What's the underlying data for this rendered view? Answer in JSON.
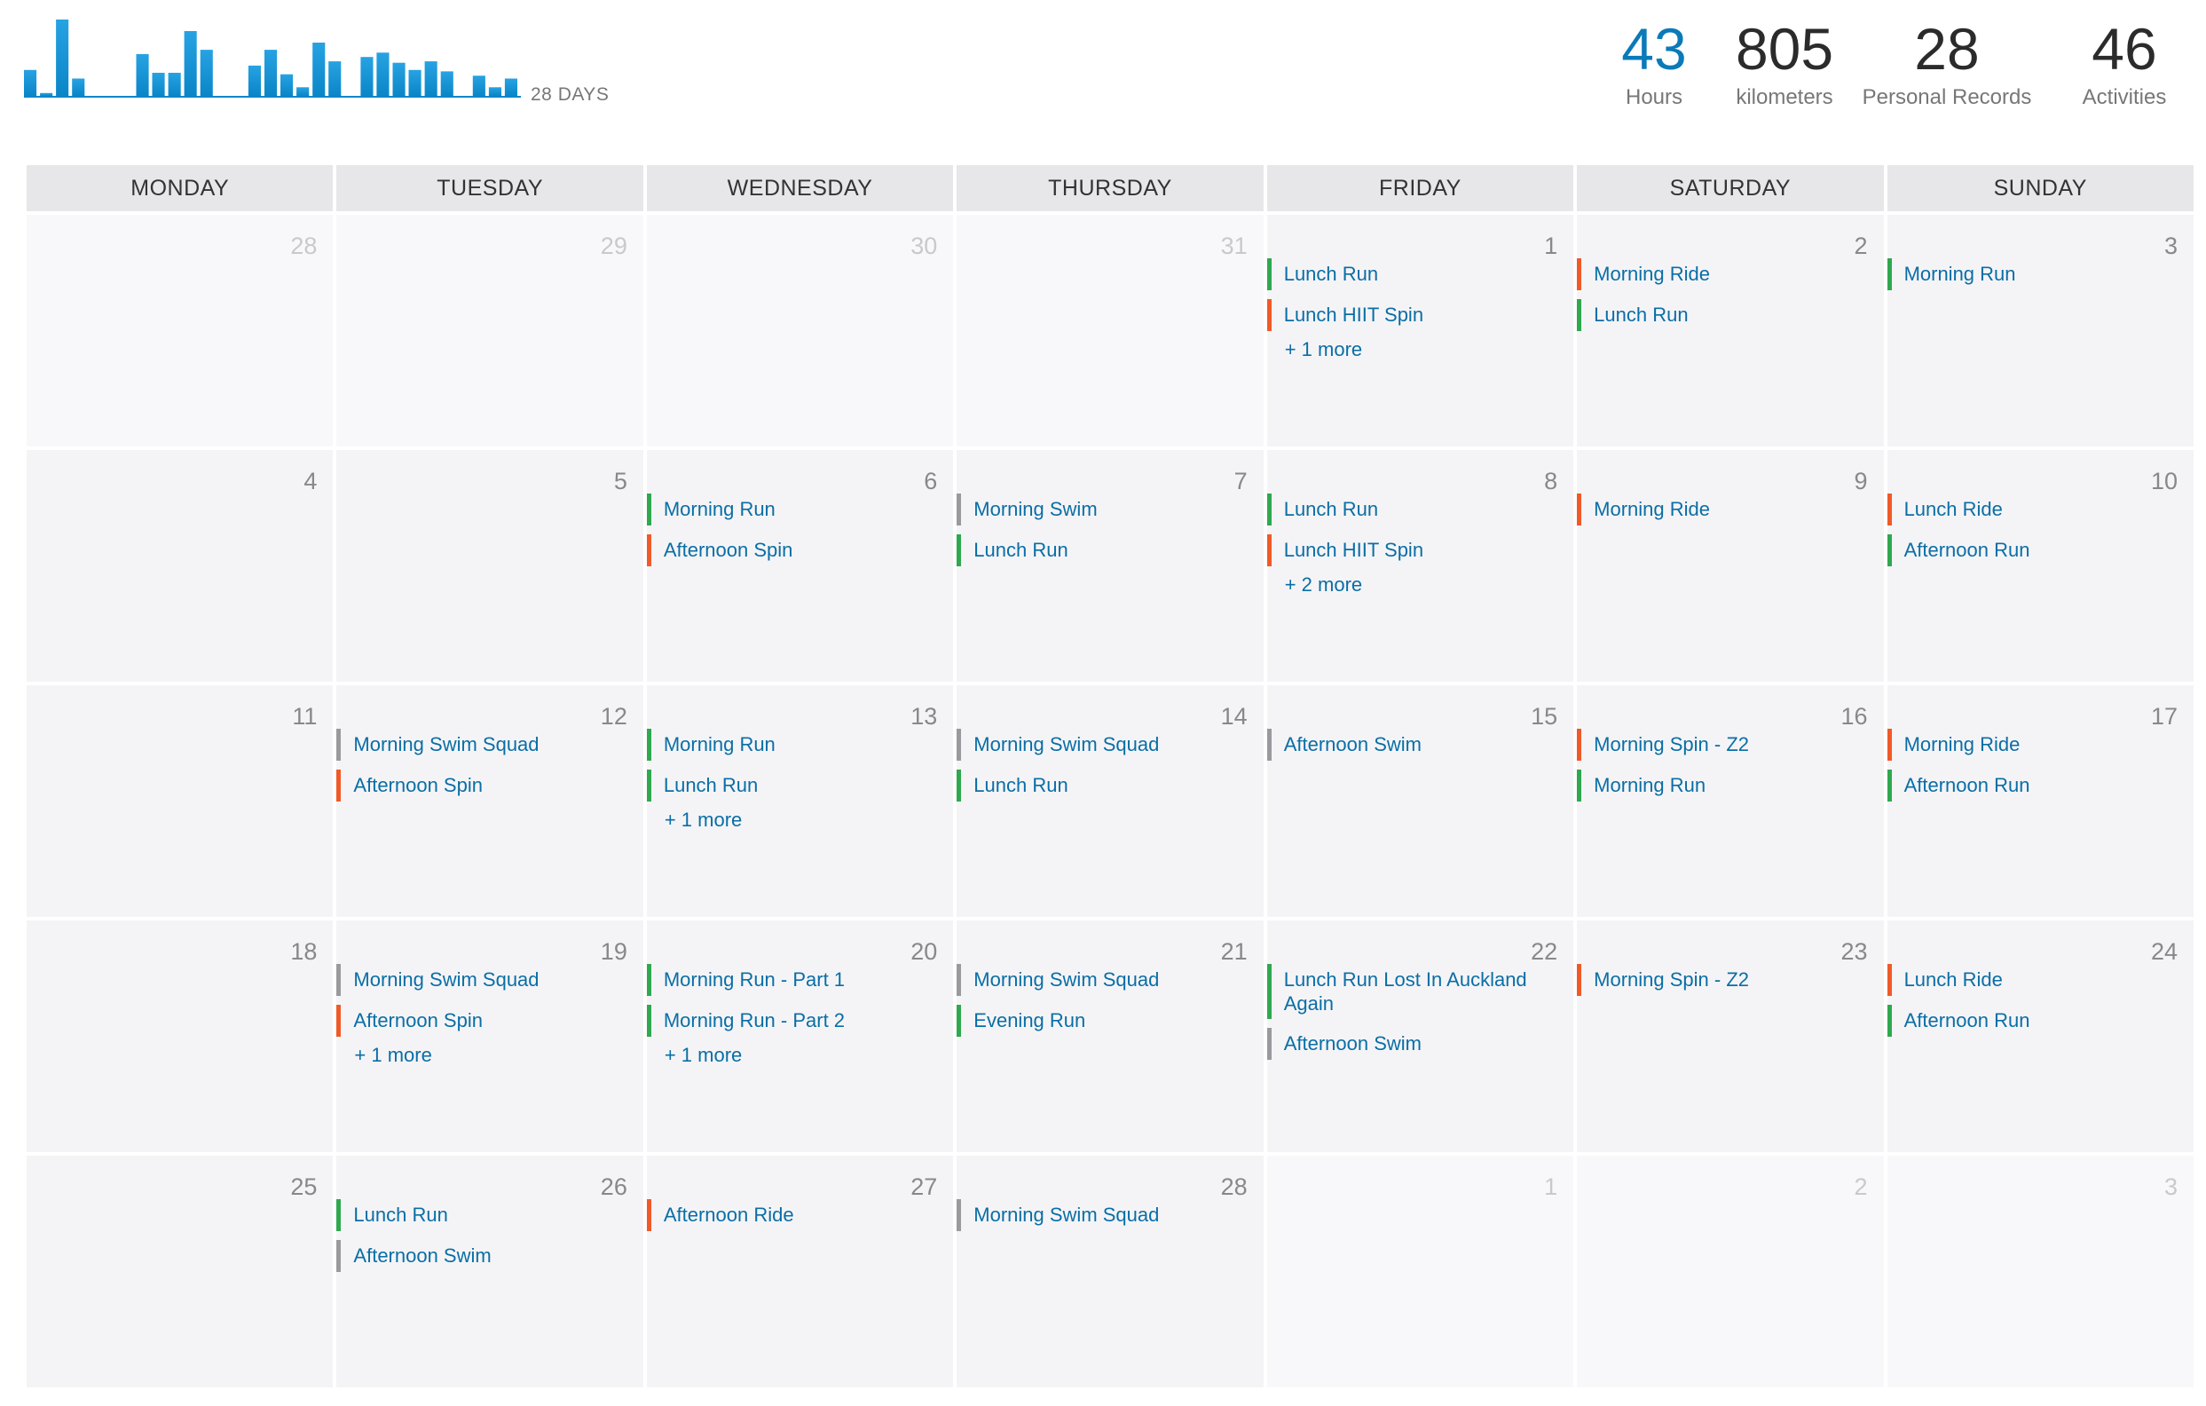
{
  "summary": {
    "days_label": "28 DAYS",
    "hours": {
      "value": "43",
      "label": "Hours"
    },
    "kilometers": {
      "value": "805",
      "label": "kilometers"
    },
    "records": {
      "value": "28",
      "label": "Personal Records"
    },
    "activities": {
      "value": "46",
      "label": "Activities"
    }
  },
  "chart_data": {
    "type": "bar",
    "title": "",
    "values": [
      1.8,
      0.2,
      5.3,
      1.2,
      0,
      0,
      0,
      2.9,
      1.6,
      1.6,
      4.5,
      3.2,
      0,
      0,
      2.1,
      3.2,
      1.5,
      0.6,
      3.7,
      2.4,
      0,
      2.7,
      3.0,
      2.3,
      1.8,
      2.4,
      1.7,
      0,
      1.4,
      0.6,
      1.2
    ],
    "color": "#0a86c8"
  },
  "calendar": {
    "day_headers": [
      "MONDAY",
      "TUESDAY",
      "WEDNESDAY",
      "THURSDAY",
      "FRIDAY",
      "SATURDAY",
      "SUNDAY"
    ],
    "weeks": [
      [
        {
          "day": "28",
          "other": true,
          "events": []
        },
        {
          "day": "29",
          "other": true,
          "events": []
        },
        {
          "day": "30",
          "other": true,
          "events": []
        },
        {
          "day": "31",
          "other": true,
          "events": []
        },
        {
          "day": "1",
          "events": [
            {
              "name": "Lunch Run",
              "type": "run"
            },
            {
              "name": "Lunch HIIT Spin",
              "type": "ride"
            }
          ],
          "more": "+ 1 more"
        },
        {
          "day": "2",
          "events": [
            {
              "name": "Morning Ride",
              "type": "ride"
            },
            {
              "name": "Lunch Run",
              "type": "run"
            }
          ]
        },
        {
          "day": "3",
          "events": [
            {
              "name": "Morning Run",
              "type": "run"
            }
          ]
        }
      ],
      [
        {
          "day": "4",
          "events": []
        },
        {
          "day": "5",
          "events": []
        },
        {
          "day": "6",
          "events": [
            {
              "name": "Morning Run",
              "type": "run"
            },
            {
              "name": "Afternoon Spin",
              "type": "ride"
            }
          ]
        },
        {
          "day": "7",
          "events": [
            {
              "name": "Morning Swim",
              "type": "swim"
            },
            {
              "name": "Lunch Run",
              "type": "run"
            }
          ]
        },
        {
          "day": "8",
          "events": [
            {
              "name": "Lunch Run",
              "type": "run"
            },
            {
              "name": "Lunch HIIT Spin",
              "type": "ride"
            }
          ],
          "more": "+ 2 more"
        },
        {
          "day": "9",
          "events": [
            {
              "name": "Morning Ride",
              "type": "ride"
            }
          ]
        },
        {
          "day": "10",
          "events": [
            {
              "name": "Lunch Ride",
              "type": "ride"
            },
            {
              "name": "Afternoon Run",
              "type": "run"
            }
          ]
        }
      ],
      [
        {
          "day": "11",
          "events": []
        },
        {
          "day": "12",
          "events": [
            {
              "name": "Morning Swim Squad",
              "type": "swim"
            },
            {
              "name": "Afternoon Spin",
              "type": "ride"
            }
          ]
        },
        {
          "day": "13",
          "events": [
            {
              "name": "Morning Run",
              "type": "run"
            },
            {
              "name": "Lunch Run",
              "type": "run"
            }
          ],
          "more": "+ 1 more"
        },
        {
          "day": "14",
          "events": [
            {
              "name": "Morning Swim Squad",
              "type": "swim"
            },
            {
              "name": "Lunch Run",
              "type": "run"
            }
          ]
        },
        {
          "day": "15",
          "events": [
            {
              "name": "Afternoon Swim",
              "type": "swim"
            }
          ]
        },
        {
          "day": "16",
          "events": [
            {
              "name": "Morning Spin - Z2",
              "type": "ride"
            },
            {
              "name": "Morning Run",
              "type": "run"
            }
          ]
        },
        {
          "day": "17",
          "events": [
            {
              "name": "Morning Ride",
              "type": "ride"
            },
            {
              "name": "Afternoon Run",
              "type": "run"
            }
          ]
        }
      ],
      [
        {
          "day": "18",
          "events": []
        },
        {
          "day": "19",
          "events": [
            {
              "name": "Morning Swim Squad",
              "type": "swim"
            },
            {
              "name": "Afternoon Spin",
              "type": "ride"
            }
          ],
          "more": "+ 1 more"
        },
        {
          "day": "20",
          "events": [
            {
              "name": "Morning Run - Part 1",
              "type": "run"
            },
            {
              "name": "Morning Run - Part 2",
              "type": "run"
            }
          ],
          "more": "+ 1 more"
        },
        {
          "day": "21",
          "events": [
            {
              "name": "Morning Swim Squad",
              "type": "swim"
            },
            {
              "name": "Evening Run",
              "type": "run"
            }
          ]
        },
        {
          "day": "22",
          "events": [
            {
              "name": "Lunch Run Lost In Auckland Again",
              "type": "run"
            },
            {
              "name": "Afternoon Swim",
              "type": "swim"
            }
          ]
        },
        {
          "day": "23",
          "events": [
            {
              "name": "Morning Spin - Z2",
              "type": "ride"
            }
          ]
        },
        {
          "day": "24",
          "events": [
            {
              "name": "Lunch Ride",
              "type": "ride"
            },
            {
              "name": "Afternoon Run",
              "type": "run"
            }
          ]
        }
      ],
      [
        {
          "day": "25",
          "events": []
        },
        {
          "day": "26",
          "events": [
            {
              "name": "Lunch Run",
              "type": "run"
            },
            {
              "name": "Afternoon Swim",
              "type": "swim"
            }
          ]
        },
        {
          "day": "27",
          "events": [
            {
              "name": "Afternoon Ride",
              "type": "ride"
            }
          ]
        },
        {
          "day": "28",
          "events": [
            {
              "name": "Morning Swim Squad",
              "type": "swim"
            }
          ]
        },
        {
          "day": "1",
          "other": true,
          "events": []
        },
        {
          "day": "2",
          "other": true,
          "events": []
        },
        {
          "day": "3",
          "other": true,
          "events": []
        }
      ]
    ]
  },
  "colors": {
    "run": "#2fa84f",
    "ride": "#f05a28",
    "swim": "#9a9a9e",
    "accent": "#0a7ab8",
    "link": "#0a6ea5"
  }
}
